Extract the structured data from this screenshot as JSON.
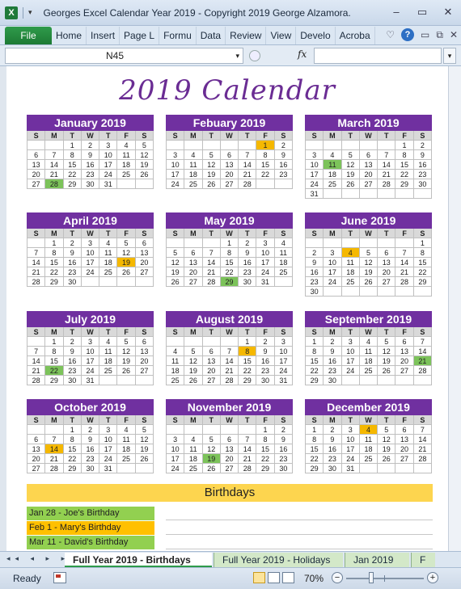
{
  "window": {
    "title": "Georges Excel Calendar Year 2019 - Copyright 2019 George Alzamora...",
    "app_icon": "X",
    "quick_access_drop": "▾",
    "buttons": {
      "minimize": "–",
      "restore": "▭",
      "close": "✕"
    }
  },
  "ribbon": {
    "file_label": "File",
    "tabs": [
      "Home",
      "Insert",
      "Page L",
      "Formu",
      "Data",
      "Review",
      "View",
      "Develo",
      "Acroba"
    ],
    "icons": {
      "collapse": "♡",
      "help": "?",
      "minimize": "▭",
      "restore": "⧉",
      "close": "✕"
    }
  },
  "formula_bar": {
    "name_box": "N45",
    "fx": "fx",
    "formula": ""
  },
  "calendar": {
    "title": "2019 Calendar",
    "dow": [
      "S",
      "M",
      "T",
      "W",
      "T",
      "F",
      "S"
    ],
    "months": [
      {
        "name": "January 2019",
        "start": 2,
        "days": 31,
        "highlights": {
          "28": "green"
        }
      },
      {
        "name": "Febuary 2019",
        "start": 5,
        "days": 28,
        "highlights": {
          "1": "orange"
        }
      },
      {
        "name": "March 2019",
        "start": 5,
        "days": 31,
        "highlights": {
          "11": "green"
        }
      },
      {
        "name": "April 2019",
        "start": 1,
        "days": 30,
        "highlights": {
          "19": "orange"
        }
      },
      {
        "name": "May 2019",
        "start": 3,
        "days": 31,
        "highlights": {
          "29": "green"
        }
      },
      {
        "name": "June 2019",
        "start": 6,
        "days": 30,
        "highlights": {
          "4": "orange"
        }
      },
      {
        "name": "July 2019",
        "start": 1,
        "days": 31,
        "highlights": {
          "22": "green"
        }
      },
      {
        "name": "August 2019",
        "start": 4,
        "days": 31,
        "highlights": {
          "8": "orange"
        }
      },
      {
        "name": "September 2019",
        "start": 0,
        "days": 30,
        "highlights": {
          "21": "green"
        }
      },
      {
        "name": "October 2019",
        "start": 2,
        "days": 31,
        "highlights": {
          "14": "orange"
        }
      },
      {
        "name": "November 2019",
        "start": 5,
        "days": 30,
        "highlights": {
          "19": "green"
        }
      },
      {
        "name": "December 2019",
        "start": 0,
        "days": 31,
        "highlights": {
          "4": "orange"
        }
      }
    ]
  },
  "birthdays": {
    "title": "Birthdays",
    "entries": [
      {
        "text": "Jan 28 - Joe's Birthday",
        "color": "green"
      },
      {
        "text": "Feb 1 - Mary's Birthday",
        "color": "orange"
      },
      {
        "text": "Mar 11 - David's Birthday",
        "color": "green"
      }
    ]
  },
  "sheet_tabs": {
    "nav": "◂◂ ◂ ▸ ▸▸",
    "tabs": [
      "Full Year 2019 - Birthdays",
      "Full Year 2019 - Holidays",
      "Jan 2019",
      "F"
    ],
    "active": 0
  },
  "status": {
    "ready": "Ready",
    "zoom": "70%",
    "zoom_minus": "−",
    "zoom_plus": "+"
  }
}
